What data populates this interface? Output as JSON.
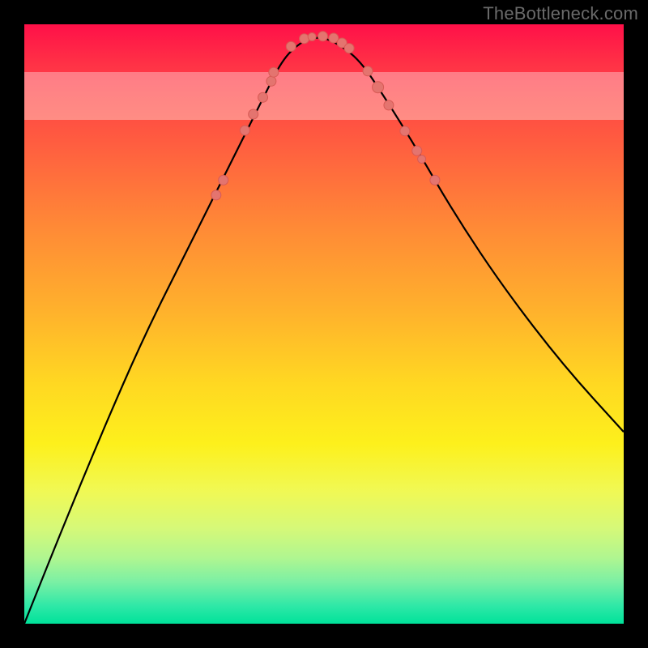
{
  "attribution": "TheBottleneck.com",
  "colors": {
    "curve": "#000000",
    "marker_fill": "#e4746f",
    "marker_stroke": "#d85a55",
    "gradient_top": "#ff1048",
    "gradient_bottom": "#00e29a",
    "optimal_band": "rgba(255,255,255,0.35)"
  },
  "chart_data": {
    "type": "line",
    "title": "",
    "xlabel": "",
    "ylabel": "",
    "x_range": [
      0,
      100
    ],
    "y_range": [
      0,
      100
    ],
    "optimal_band": {
      "y_min": 84,
      "y_max": 92
    },
    "curve": {
      "name": "bottleneck-curve",
      "x": [
        0,
        6,
        13,
        20,
        27,
        32,
        36,
        40,
        43,
        46,
        49,
        52,
        56,
        60,
        65,
        72,
        80,
        90,
        100
      ],
      "y": [
        0,
        15,
        32,
        48,
        62,
        72,
        80,
        88,
        94,
        97,
        98,
        97,
        94,
        88,
        80,
        68,
        56,
        43,
        32
      ]
    },
    "markers": [
      {
        "x": 32.0,
        "y": 71.5,
        "r": 6
      },
      {
        "x": 33.2,
        "y": 74.0,
        "r": 6
      },
      {
        "x": 36.8,
        "y": 82.3,
        "r": 6
      },
      {
        "x": 38.2,
        "y": 85.0,
        "r": 6
      },
      {
        "x": 39.8,
        "y": 87.8,
        "r": 6
      },
      {
        "x": 41.2,
        "y": 90.5,
        "r": 6
      },
      {
        "x": 41.6,
        "y": 92.0,
        "r": 6
      },
      {
        "x": 44.5,
        "y": 96.3,
        "r": 6
      },
      {
        "x": 46.7,
        "y": 97.6,
        "r": 6
      },
      {
        "x": 48.0,
        "y": 97.9,
        "r": 5
      },
      {
        "x": 49.8,
        "y": 98.0,
        "r": 6
      },
      {
        "x": 51.6,
        "y": 97.7,
        "r": 6
      },
      {
        "x": 53.0,
        "y": 96.9,
        "r": 6
      },
      {
        "x": 54.2,
        "y": 96.0,
        "r": 6
      },
      {
        "x": 57.3,
        "y": 92.2,
        "r": 6
      },
      {
        "x": 59.0,
        "y": 89.5,
        "r": 7
      },
      {
        "x": 60.8,
        "y": 86.5,
        "r": 6
      },
      {
        "x": 63.5,
        "y": 82.2,
        "r": 6
      },
      {
        "x": 65.5,
        "y": 78.9,
        "r": 6
      },
      {
        "x": 66.3,
        "y": 77.5,
        "r": 5
      },
      {
        "x": 68.5,
        "y": 74.0,
        "r": 6
      }
    ]
  }
}
